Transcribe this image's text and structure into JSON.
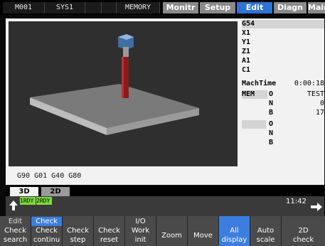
{
  "topbar": {
    "cells": [
      "M001",
      "SYS1",
      "",
      "",
      "MEMORY"
    ],
    "tabs": [
      "Monitr",
      "Setup",
      "Edit",
      "Diagn",
      "Mainte"
    ]
  },
  "info": {
    "header": "G54",
    "axes": [
      "X1",
      "Y1",
      "Z1",
      "A1",
      "C1"
    ],
    "mach_time_label": "MachTime",
    "mach_time": "0:00:18",
    "mem": "MEM",
    "o1": "O",
    "o1_val": "TEST",
    "n1": "N",
    "n1_val": "0",
    "b1": "B",
    "b1_val": "17",
    "o2": "O",
    "n2": "N",
    "b2": "B"
  },
  "modal_line": "G90 G01 G40 G80",
  "view_tabs": [
    "3D",
    "2D"
  ],
  "status": {
    "rdy1": "1RDY",
    "rdy2": "2RDY",
    "clock": "11:42"
  },
  "fkeys": [
    {
      "top": "Edit",
      "bottom": "Check\nsearch"
    },
    {
      "top": "Check",
      "bottom": "Check\ncontinu"
    },
    {
      "top": "",
      "bottom": "Check\nstep"
    },
    {
      "top": "",
      "bottom": "Check\nreset"
    },
    {
      "top": "I/O",
      "bottom": "Work\ninit"
    },
    {
      "top": "",
      "bottom": "Zoom"
    },
    {
      "top": "",
      "bottom": "Move"
    },
    {
      "top": "",
      "bottom": "All\ndisplay"
    },
    {
      "top": "",
      "bottom": "Auto\nscale"
    },
    {
      "top": "",
      "bottom": "2D\ncheck"
    }
  ],
  "colors": {
    "accent_blue": "#2d73d6",
    "ready_green": "#7bdc3a"
  }
}
